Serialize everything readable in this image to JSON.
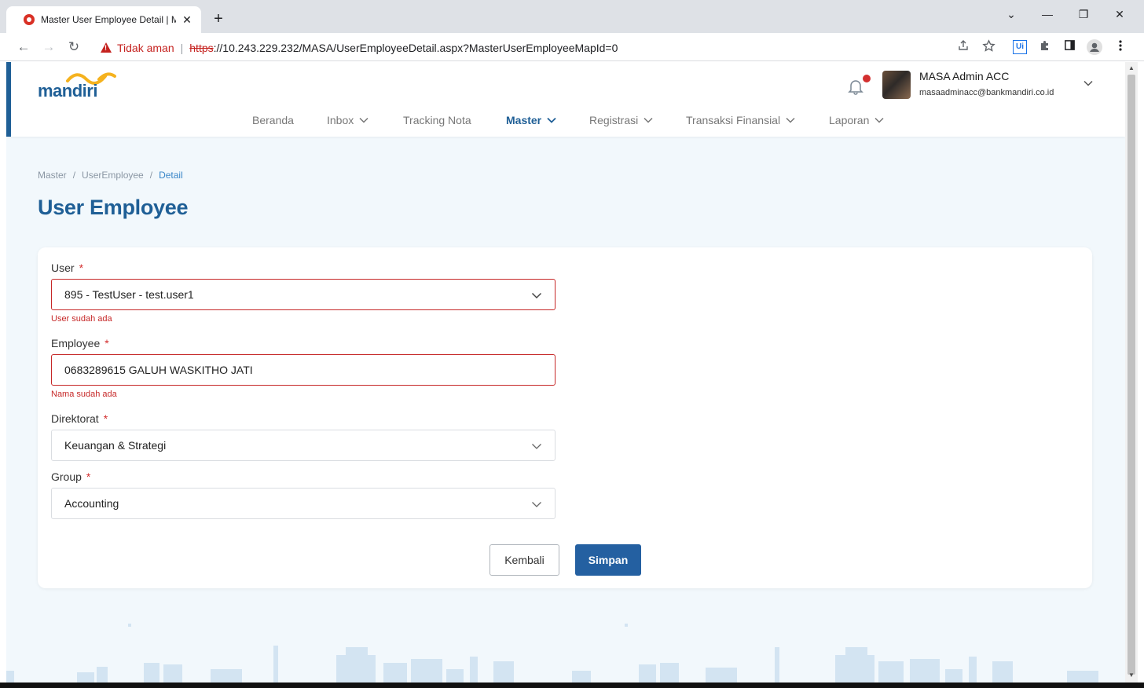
{
  "browser": {
    "tab_title": "Master User Employee Detail | M",
    "tab_close": "✕",
    "new_tab": "+",
    "win_minimize": "—",
    "win_restore": "❐",
    "win_close": "✕",
    "win_tabsearch": "⌄",
    "back": "←",
    "forward": "→",
    "reload": "↻",
    "security_label": "Tidak aman",
    "url_scheme": "https",
    "url_rest": "://10.243.229.232/MASA/UserEmployeeDetail.aspx?MasterUserEmployeeMapId=0",
    "ext_ui": "Ui"
  },
  "header": {
    "logo_text": "mandiri",
    "user_name": "MASA Admin ACC",
    "user_email": "masaadminacc@bankmandiri.co.id"
  },
  "nav": {
    "items": [
      {
        "label": "Beranda"
      },
      {
        "label": "Inbox"
      },
      {
        "label": "Tracking Nota"
      },
      {
        "label": "Master"
      },
      {
        "label": "Registrasi"
      },
      {
        "label": "Transaksi Finansial"
      },
      {
        "label": "Laporan"
      }
    ]
  },
  "breadcrumb": [
    "Master",
    "UserEmployee",
    "Detail"
  ],
  "breadcrumb_sep": "/",
  "page_title": "User Employee",
  "form": {
    "required_mark": "*",
    "user": {
      "label": "User",
      "value": "895 - TestUser - test.user1",
      "error": "User sudah ada"
    },
    "employee": {
      "label": "Employee",
      "value": "0683289615 GALUH WASKITHO JATI",
      "error": "Nama sudah ada"
    },
    "direktorat": {
      "label": "Direktorat",
      "value": "Keuangan & Strategi"
    },
    "group": {
      "label": "Group",
      "value": "Accounting"
    }
  },
  "buttons": {
    "back": "Kembali",
    "save": "Simpan"
  },
  "colors": {
    "primary": "#1f5f96",
    "button": "#2460a1",
    "error": "#c62828",
    "background": "#f2f8fc"
  }
}
